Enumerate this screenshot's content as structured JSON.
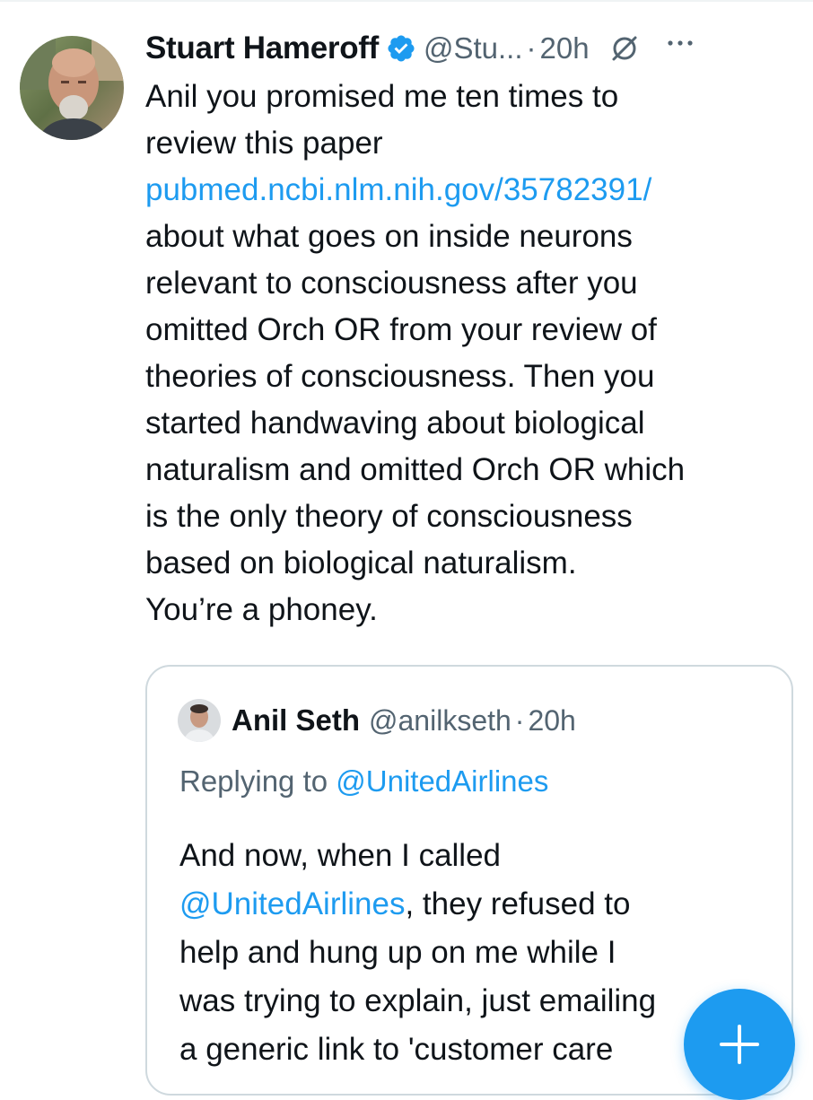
{
  "tweet": {
    "display_name": "Stuart Hameroff",
    "handle": "@Stu...",
    "separator": "·",
    "time": "20h",
    "text_lines": [
      "Anil you promised me ten times to",
      "review this paper",
      "pubmed.ncbi.nlm.nih.gov/35782391/",
      "about what goes on inside neurons",
      "relevant to consciousness after you",
      "omitted Orch OR from your review of",
      "theories of consciousness. Then you",
      "started handwaving about biological",
      "naturalism and omitted Orch OR which",
      "is the only theory of consciousness",
      "based on biological naturalism.",
      "You’re a phoney."
    ]
  },
  "quote": {
    "display_name": "Anil Seth",
    "handle": "@anilkseth",
    "separator": "·",
    "time": "20h",
    "replying_prefix": "Replying to ",
    "replying_to": "@UnitedAirlines",
    "line1": "And now, when I called",
    "line2_mention": "@UnitedAirlines",
    "line2_rest": ", they refused to",
    "line3": "help and hung up on me while I",
    "line4": "was trying to explain, just emailing",
    "line5": "a generic link to 'customer care"
  },
  "icons": {
    "verified": "verified-badge-icon",
    "time": "no-entry-icon",
    "more": "more-dots-icon",
    "compose": "plus-icon"
  },
  "colors": {
    "link": "#1d9bf0",
    "secondary_text": "#536471",
    "border": "#cfd9de",
    "fab": "#1d9bf0"
  }
}
